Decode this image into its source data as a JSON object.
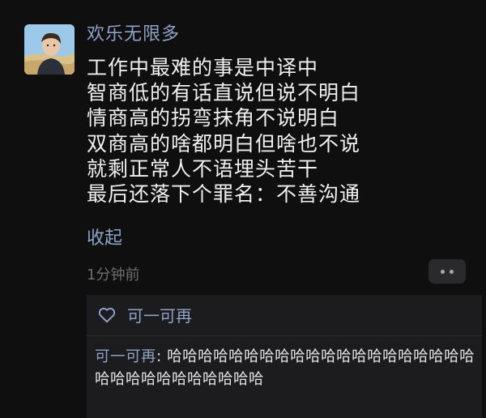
{
  "post": {
    "username": "欢乐无限多",
    "lines": [
      "工作中最难的事是中译中",
      "智商低的有话直说但说不明白",
      "情商高的拐弯抹角不说明白",
      "双商高的啥都明白但啥也不说",
      "就剩正常人不语埋头苦干",
      "最后还落下个罪名：不善沟通"
    ],
    "collapse_label": "收起",
    "timestamp": "1分钟前"
  },
  "interaction": {
    "likes": [
      "可一可再"
    ],
    "comment": {
      "author": "可一可再",
      "separator": ": ",
      "text": "哈哈哈哈哈哈哈哈哈哈哈哈哈哈哈哈哈哈哈哈哈哈哈哈哈哈哈哈哈哈哈"
    }
  },
  "colors": {
    "background": "#0f0f10",
    "name_blue": "#8ea3c4",
    "text": "#f0f0f0",
    "panel": "#1c1c1e"
  },
  "icons": {
    "like": "heart-outline-icon",
    "more": "more-dots-icon"
  }
}
